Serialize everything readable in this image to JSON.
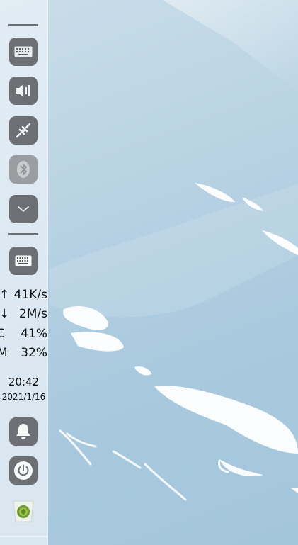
{
  "wallpaper": {
    "name": "sky-wallpaper"
  },
  "tray": {
    "keyboard_icon": "keyboard-icon",
    "volume_icon": "volume-icon",
    "network_icon": "network-icon",
    "bluetooth_icon": "bluetooth-icon",
    "expand_icon": "chevron-down-icon",
    "input_method_icon": "keyboard-icon"
  },
  "net": {
    "up_arrow": "↑",
    "up_speed": "41K/s",
    "down_arrow": "↓",
    "down_speed": "2M/s"
  },
  "sys": {
    "cpu_label": "C",
    "cpu_value": "41%",
    "mem_label": "M",
    "mem_value": "32%"
  },
  "clock": {
    "time": "20:42",
    "date": "2021/1/16"
  },
  "actions": {
    "notification_icon": "bell-icon",
    "power_icon": "power-icon",
    "trash_icon": "trash-icon"
  },
  "colors": {
    "panel_bg": "#e8f0f6",
    "button_bg": "#6c6f73",
    "button_dim": "#9a9da1",
    "wallpaper": "#b9d3e3"
  }
}
